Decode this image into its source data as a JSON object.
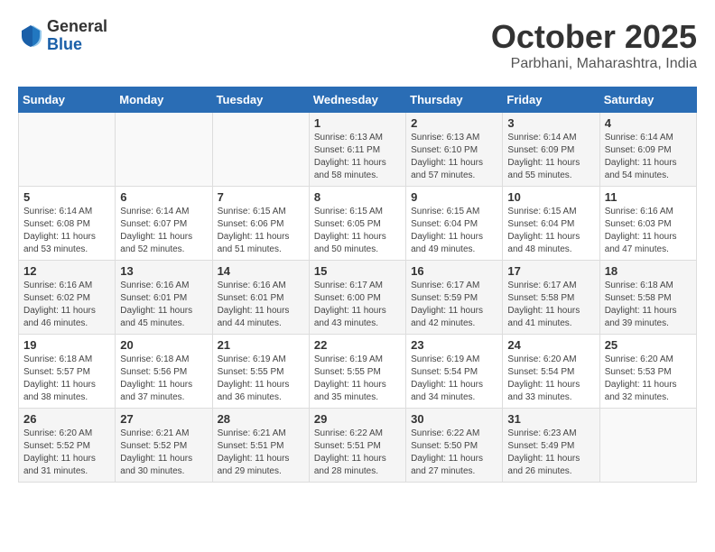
{
  "header": {
    "logo_general": "General",
    "logo_blue": "Blue",
    "title": "October 2025",
    "subtitle": "Parbhani, Maharashtra, India"
  },
  "days_of_week": [
    "Sunday",
    "Monday",
    "Tuesday",
    "Wednesday",
    "Thursday",
    "Friday",
    "Saturday"
  ],
  "weeks": [
    [
      {
        "day": "",
        "info": ""
      },
      {
        "day": "",
        "info": ""
      },
      {
        "day": "",
        "info": ""
      },
      {
        "day": "1",
        "info": "Sunrise: 6:13 AM\nSunset: 6:11 PM\nDaylight: 11 hours and 58 minutes."
      },
      {
        "day": "2",
        "info": "Sunrise: 6:13 AM\nSunset: 6:10 PM\nDaylight: 11 hours and 57 minutes."
      },
      {
        "day": "3",
        "info": "Sunrise: 6:14 AM\nSunset: 6:09 PM\nDaylight: 11 hours and 55 minutes."
      },
      {
        "day": "4",
        "info": "Sunrise: 6:14 AM\nSunset: 6:09 PM\nDaylight: 11 hours and 54 minutes."
      }
    ],
    [
      {
        "day": "5",
        "info": "Sunrise: 6:14 AM\nSunset: 6:08 PM\nDaylight: 11 hours and 53 minutes."
      },
      {
        "day": "6",
        "info": "Sunrise: 6:14 AM\nSunset: 6:07 PM\nDaylight: 11 hours and 52 minutes."
      },
      {
        "day": "7",
        "info": "Sunrise: 6:15 AM\nSunset: 6:06 PM\nDaylight: 11 hours and 51 minutes."
      },
      {
        "day": "8",
        "info": "Sunrise: 6:15 AM\nSunset: 6:05 PM\nDaylight: 11 hours and 50 minutes."
      },
      {
        "day": "9",
        "info": "Sunrise: 6:15 AM\nSunset: 6:04 PM\nDaylight: 11 hours and 49 minutes."
      },
      {
        "day": "10",
        "info": "Sunrise: 6:15 AM\nSunset: 6:04 PM\nDaylight: 11 hours and 48 minutes."
      },
      {
        "day": "11",
        "info": "Sunrise: 6:16 AM\nSunset: 6:03 PM\nDaylight: 11 hours and 47 minutes."
      }
    ],
    [
      {
        "day": "12",
        "info": "Sunrise: 6:16 AM\nSunset: 6:02 PM\nDaylight: 11 hours and 46 minutes."
      },
      {
        "day": "13",
        "info": "Sunrise: 6:16 AM\nSunset: 6:01 PM\nDaylight: 11 hours and 45 minutes."
      },
      {
        "day": "14",
        "info": "Sunrise: 6:16 AM\nSunset: 6:01 PM\nDaylight: 11 hours and 44 minutes."
      },
      {
        "day": "15",
        "info": "Sunrise: 6:17 AM\nSunset: 6:00 PM\nDaylight: 11 hours and 43 minutes."
      },
      {
        "day": "16",
        "info": "Sunrise: 6:17 AM\nSunset: 5:59 PM\nDaylight: 11 hours and 42 minutes."
      },
      {
        "day": "17",
        "info": "Sunrise: 6:17 AM\nSunset: 5:58 PM\nDaylight: 11 hours and 41 minutes."
      },
      {
        "day": "18",
        "info": "Sunrise: 6:18 AM\nSunset: 5:58 PM\nDaylight: 11 hours and 39 minutes."
      }
    ],
    [
      {
        "day": "19",
        "info": "Sunrise: 6:18 AM\nSunset: 5:57 PM\nDaylight: 11 hours and 38 minutes."
      },
      {
        "day": "20",
        "info": "Sunrise: 6:18 AM\nSunset: 5:56 PM\nDaylight: 11 hours and 37 minutes."
      },
      {
        "day": "21",
        "info": "Sunrise: 6:19 AM\nSunset: 5:55 PM\nDaylight: 11 hours and 36 minutes."
      },
      {
        "day": "22",
        "info": "Sunrise: 6:19 AM\nSunset: 5:55 PM\nDaylight: 11 hours and 35 minutes."
      },
      {
        "day": "23",
        "info": "Sunrise: 6:19 AM\nSunset: 5:54 PM\nDaylight: 11 hours and 34 minutes."
      },
      {
        "day": "24",
        "info": "Sunrise: 6:20 AM\nSunset: 5:54 PM\nDaylight: 11 hours and 33 minutes."
      },
      {
        "day": "25",
        "info": "Sunrise: 6:20 AM\nSunset: 5:53 PM\nDaylight: 11 hours and 32 minutes."
      }
    ],
    [
      {
        "day": "26",
        "info": "Sunrise: 6:20 AM\nSunset: 5:52 PM\nDaylight: 11 hours and 31 minutes."
      },
      {
        "day": "27",
        "info": "Sunrise: 6:21 AM\nSunset: 5:52 PM\nDaylight: 11 hours and 30 minutes."
      },
      {
        "day": "28",
        "info": "Sunrise: 6:21 AM\nSunset: 5:51 PM\nDaylight: 11 hours and 29 minutes."
      },
      {
        "day": "29",
        "info": "Sunrise: 6:22 AM\nSunset: 5:51 PM\nDaylight: 11 hours and 28 minutes."
      },
      {
        "day": "30",
        "info": "Sunrise: 6:22 AM\nSunset: 5:50 PM\nDaylight: 11 hours and 27 minutes."
      },
      {
        "day": "31",
        "info": "Sunrise: 6:23 AM\nSunset: 5:49 PM\nDaylight: 11 hours and 26 minutes."
      },
      {
        "day": "",
        "info": ""
      }
    ]
  ]
}
